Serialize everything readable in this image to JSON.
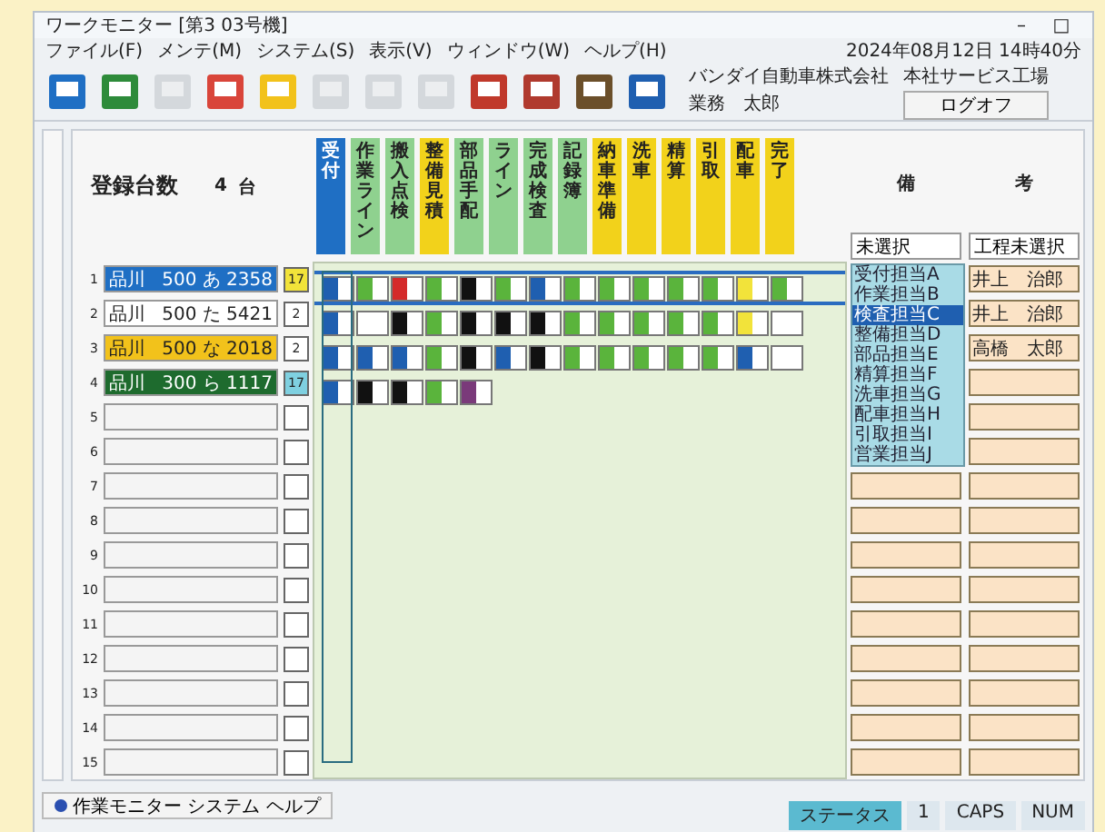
{
  "window": {
    "title": "ワークモニター [第3 03号機]",
    "controls": [
      "–",
      "□"
    ]
  },
  "menu": [
    "ファイル(F)",
    "メンテ(M)",
    "システム(S)",
    "表示(V)",
    "ウィンドウ(W)",
    "ヘルプ(H)"
  ],
  "datetime": "2024年08月12日 14時40分",
  "toolbar": [
    {
      "disabled": false
    },
    {
      "disabled": false
    },
    {
      "disabled": true
    },
    {
      "disabled": false
    },
    {
      "disabled": false
    },
    {
      "disabled": true
    },
    {
      "disabled": true
    },
    {
      "disabled": true
    },
    {
      "disabled": false
    },
    {
      "disabled": false
    },
    {
      "disabled": false
    },
    {
      "disabled": false
    }
  ],
  "company": "バンダイ自動車株式会社",
  "branch": "本社サービス工場",
  "user": "業務　太郎",
  "logoff": "ログオフ",
  "count": {
    "label": "登録台数",
    "value": "4",
    "unit": "台"
  },
  "stages": [
    {
      "label": "受付",
      "color": "#1f6fc4"
    },
    {
      "label": "作業ライン",
      "color": "#8fd18f"
    },
    {
      "label": "搬入点検",
      "color": "#8fd18f"
    },
    {
      "label": "整備見積",
      "color": "#f2d21b"
    },
    {
      "label": "部品手配",
      "color": "#8fd18f"
    },
    {
      "label": "ライン",
      "color": "#8fd18f"
    },
    {
      "label": "完成検査",
      "color": "#8fd18f"
    },
    {
      "label": "記録簿",
      "color": "#8fd18f"
    },
    {
      "label": "納車準備",
      "color": "#f2d21b"
    },
    {
      "label": "洗車",
      "color": "#f2d21b"
    },
    {
      "label": "精算",
      "color": "#f2d21b"
    },
    {
      "label": "引取",
      "color": "#f2d21b"
    },
    {
      "label": "配車",
      "color": "#f2d21b"
    },
    {
      "label": "完了",
      "color": "#f2d21b"
    }
  ],
  "remarks_header": [
    "備",
    "考"
  ],
  "filters": [
    "未選択",
    "工程未選択"
  ],
  "dropdown": {
    "items": [
      {
        "label": "受付担当A",
        "selected": false
      },
      {
        "label": "作業担当B",
        "selected": false
      },
      {
        "label": "検査担当C",
        "selected": true
      },
      {
        "label": "整備担当D",
        "selected": false
      },
      {
        "label": "部品担当E",
        "selected": false
      },
      {
        "label": "精算担当F",
        "selected": false
      },
      {
        "label": "洗車担当G",
        "selected": false
      },
      {
        "label": "配車担当H",
        "selected": false
      },
      {
        "label": "引取担当I",
        "selected": false
      },
      {
        "label": "営業担当J",
        "selected": false
      }
    ]
  },
  "vehicles": [
    {
      "number": "1",
      "area": "品川",
      "plate": "500 あ 2358",
      "color": "#1f6fc4",
      "badge": {
        "text": "17",
        "color": "#f2e33a"
      },
      "selected": true,
      "cells": [
        {
          "color": "#1f5fb0"
        },
        {
          "color": "#5ab43c"
        },
        {
          "color": "#d42a2a"
        },
        {
          "color": "#5ab43c"
        },
        {
          "color": "#111111"
        },
        {
          "color": "#5ab43c"
        },
        {
          "color": "#1f5fb0"
        },
        {
          "color": "#5ab43c"
        },
        {
          "color": "#5ab43c"
        },
        {
          "color": "#5ab43c"
        },
        {
          "color": "#5ab43c"
        },
        {
          "color": "#5ab43c"
        },
        {
          "color": "#f2e33a"
        },
        {
          "color": "#5ab43c"
        }
      ],
      "remark": "井上　治郎"
    },
    {
      "number": "2",
      "area": "品川",
      "plate": "500 た 5421",
      "color": "#ffffff",
      "badge": {
        "text": "2",
        "color": "#ffffff"
      },
      "selected": false,
      "cells": [
        {
          "color": "#1f5fb0"
        },
        {
          "color": "#ffffff"
        },
        {
          "color": "#111111"
        },
        {
          "color": "#5ab43c"
        },
        {
          "color": "#111111"
        },
        {
          "color": "#111111"
        },
        {
          "color": "#111111"
        },
        {
          "color": "#5ab43c"
        },
        {
          "color": "#5ab43c"
        },
        {
          "color": "#5ab43c"
        },
        {
          "color": "#5ab43c"
        },
        {
          "color": "#5ab43c"
        },
        {
          "color": "#f2e33a"
        },
        {
          "color": "#ffffff"
        }
      ],
      "remark": "井上　治郎"
    },
    {
      "number": "3",
      "area": "品川",
      "plate": "500 な 2018",
      "color": "#f2c21b",
      "badge": {
        "text": "2",
        "color": "#ffffff"
      },
      "selected": false,
      "cells": [
        {
          "color": "#1f5fb0"
        },
        {
          "color": "#1f5fb0"
        },
        {
          "color": "#1f5fb0"
        },
        {
          "color": "#5ab43c"
        },
        {
          "color": "#111111"
        },
        {
          "color": "#1f5fb0"
        },
        {
          "color": "#111111"
        },
        {
          "color": "#5ab43c"
        },
        {
          "color": "#5ab43c"
        },
        {
          "color": "#5ab43c"
        },
        {
          "color": "#5ab43c"
        },
        {
          "color": "#5ab43c"
        },
        {
          "color": "#1f5fb0"
        },
        {
          "color": "#ffffff"
        }
      ],
      "remark": "高橋　太郎"
    },
    {
      "number": "4",
      "area": "品川",
      "plate": "300 ら 1117",
      "color": "#1e6b2e",
      "badge": {
        "text": "17",
        "color": "#7fd0e0"
      },
      "selected": false,
      "cells": [
        {
          "color": "#1f5fb0"
        },
        {
          "color": "#111111"
        },
        {
          "color": "#111111"
        },
        {
          "color": "#5ab43c"
        },
        {
          "color": "#7a3a7a"
        }
      ]
    },
    {
      "number": "5"
    },
    {
      "number": "6"
    },
    {
      "number": "7"
    },
    {
      "number": "8"
    },
    {
      "number": "9"
    },
    {
      "number": "10"
    },
    {
      "number": "11"
    },
    {
      "number": "12"
    },
    {
      "number": "13"
    },
    {
      "number": "14"
    },
    {
      "number": "15"
    }
  ],
  "bottom_tab": "作業モニター システム ヘルプ",
  "status_bar": [
    {
      "text": "ステータス",
      "selected": true
    },
    {
      "text": "1",
      "selected": false
    },
    {
      "text": "CAPS",
      "selected": false
    },
    {
      "text": "NUM",
      "selected": false
    }
  ]
}
